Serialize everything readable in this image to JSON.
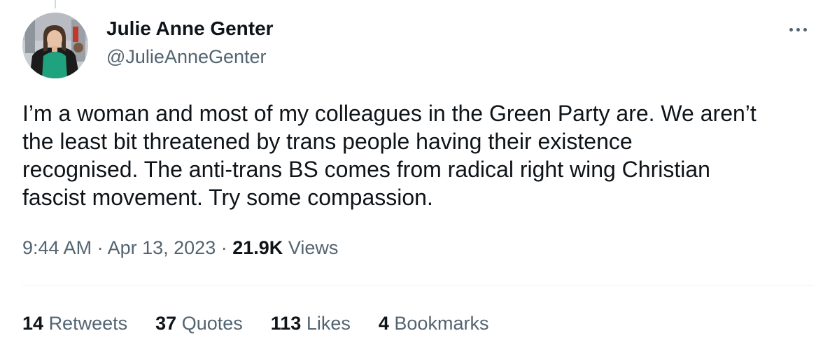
{
  "tweet": {
    "author": {
      "display_name": "Julie Anne Genter",
      "handle": "@JulieAnneGenter"
    },
    "text_lines": [
      "I’m a woman and most of my colleagues in the Green Party are. We aren’t",
      "the least bit threatened by trans people having their existence",
      "recognised. The anti-trans BS comes from radical right wing Christian",
      "fascist movement. Try some compassion."
    ],
    "time": "9:44 AM",
    "separator": "·",
    "date": "Apr 13, 2023",
    "views_count": "21.9K",
    "views_label": "Views",
    "stats": {
      "retweets_count": "14",
      "retweets_label": "Retweets",
      "quotes_count": "37",
      "quotes_label": "Quotes",
      "likes_count": "113",
      "likes_label": "Likes",
      "bookmarks_count": "4",
      "bookmarks_label": "Bookmarks"
    }
  },
  "icons": {
    "more": "more-horizontal-icon"
  },
  "colors": {
    "primary_text": "#0f1419",
    "secondary_text": "#536471",
    "divider": "#eff3f4",
    "avatar_shirt": "#1fa37e"
  }
}
